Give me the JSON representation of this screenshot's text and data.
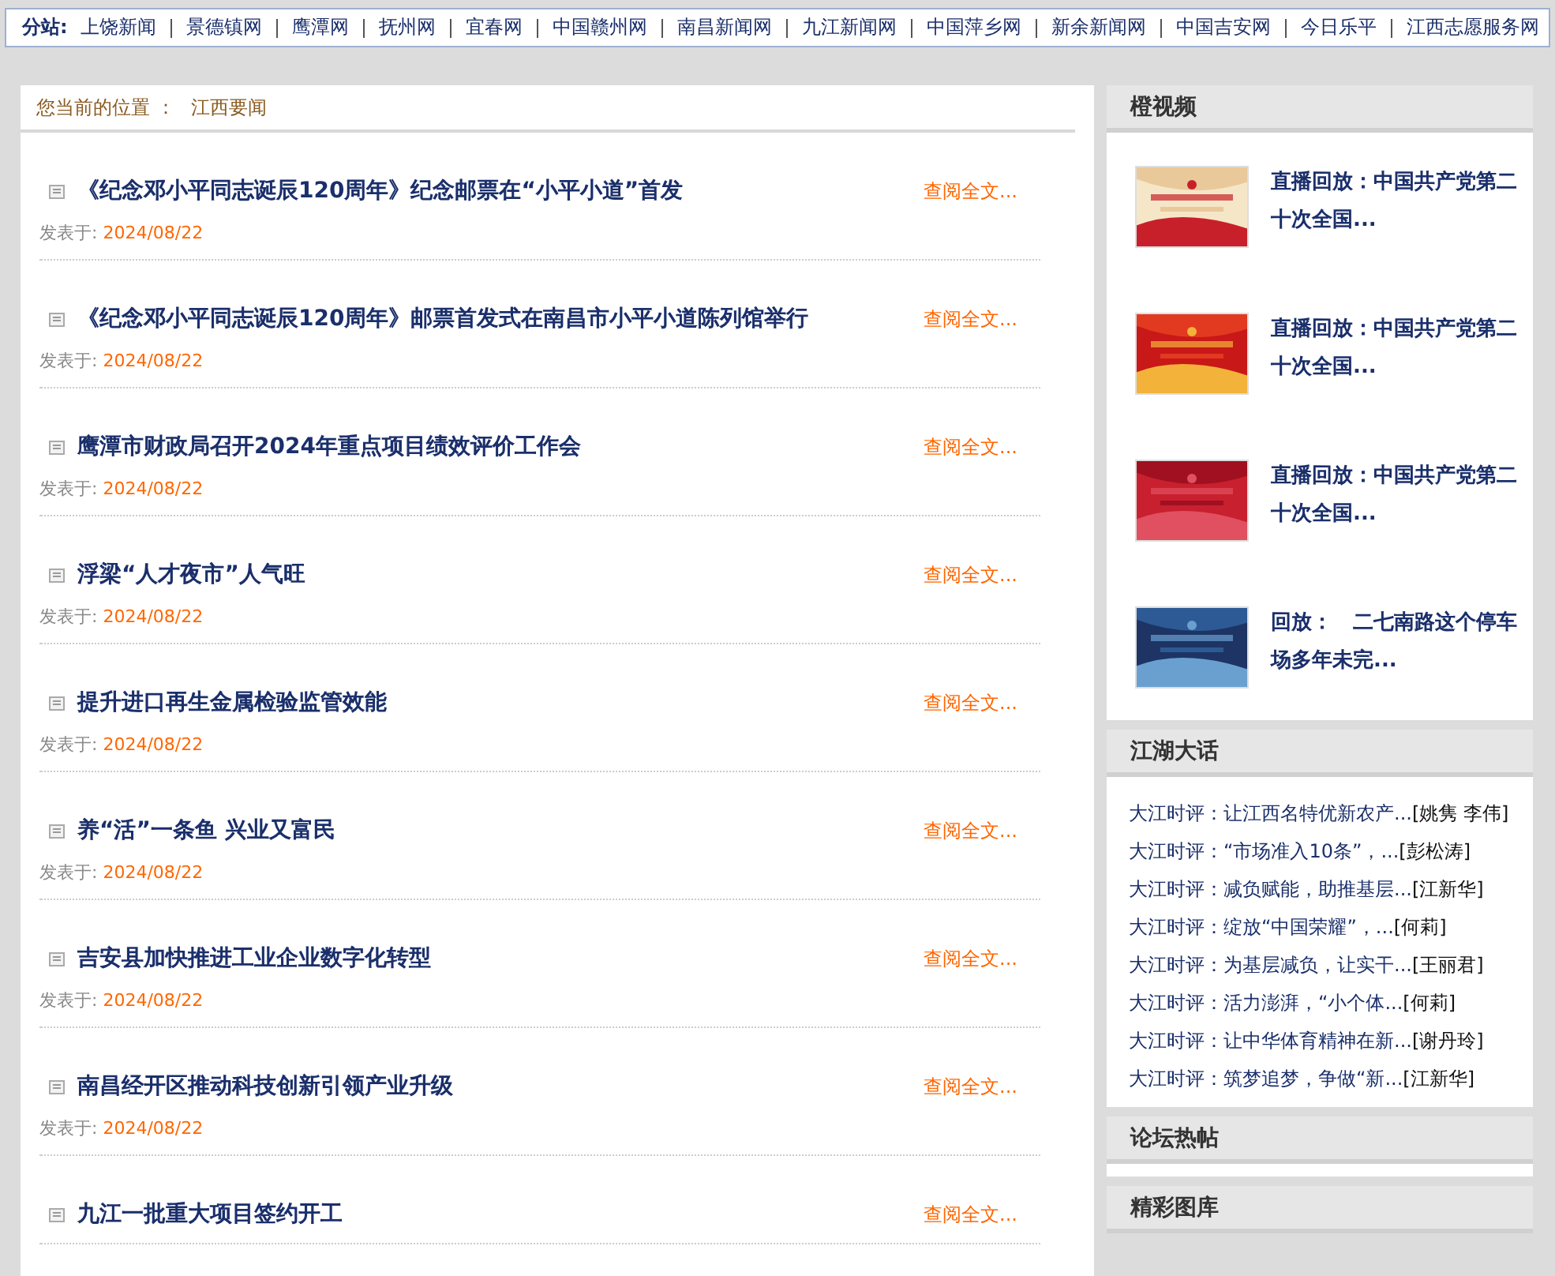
{
  "substation_bar": {
    "label": "分站:",
    "links": [
      "上饶新闻",
      "景德镇网",
      "鹰潭网",
      "抚州网",
      "宜春网",
      "中国赣州网",
      "南昌新闻网",
      "九江新闻网",
      "中国萍乡网",
      "新余新闻网",
      "中国吉安网",
      "今日乐平",
      "江西志愿服务网"
    ]
  },
  "breadcrumb": {
    "label": "您当前的位置 ：",
    "current": "江西要闻"
  },
  "articles": [
    {
      "title": "《纪念邓小平同志诞辰120周年》纪念邮票在“小平小道”首发",
      "date_label": "发表于:",
      "date": "2024/08/22",
      "more": "查阅全文..."
    },
    {
      "title": "《纪念邓小平同志诞辰120周年》邮票首发式在南昌市小平小道陈列馆举行",
      "date_label": "发表于:",
      "date": "2024/08/22",
      "more": "查阅全文..."
    },
    {
      "title": "鹰潭市财政局召开2024年重点项目绩效评价工作会",
      "date_label": "发表于:",
      "date": "2024/08/22",
      "more": "查阅全文..."
    },
    {
      "title": "浮梁“人才夜市”人气旺",
      "date_label": "发表于:",
      "date": "2024/08/22",
      "more": "查阅全文..."
    },
    {
      "title": "提升进口再生金属检验监管效能",
      "date_label": "发表于:",
      "date": "2024/08/22",
      "more": "查阅全文..."
    },
    {
      "title": "养“活”一条鱼 兴业又富民",
      "date_label": "发表于:",
      "date": "2024/08/22",
      "more": "查阅全文..."
    },
    {
      "title": "吉安县加快推进工业企业数字化转型",
      "date_label": "发表于:",
      "date": "2024/08/22",
      "more": "查阅全文..."
    },
    {
      "title": "南昌经开区推动科技创新引领产业升级",
      "date_label": "发表于:",
      "date": "2024/08/22",
      "more": "查阅全文..."
    },
    {
      "title": "九江一批重大项目签约开工",
      "more": "查阅全文..."
    }
  ],
  "sidebar": {
    "video_section": {
      "title": "橙视频",
      "items": [
        {
          "kind": "picture",
          "caption": "直播回放：中国共产党第二十次全国..."
        },
        {
          "kind": "picture",
          "caption": "直播回放：中国共产党第二十次全国..."
        },
        {
          "kind": "picture",
          "caption": "直播回放：中国共产党第二十次全国..."
        },
        {
          "kind": "picture",
          "caption": "回放：　二七南路这个停车场多年未完..."
        }
      ]
    },
    "talk_section": {
      "title": "江湖大话",
      "items": [
        {
          "title": "大江时评：让江西名特优新农产...",
          "author": "[姚隽 李伟]"
        },
        {
          "title": "大江时评：“市场准入10条”，...",
          "author": "[彭松涛]"
        },
        {
          "title": "大江时评：减负赋能，助推基层...",
          "author": "[江新华]"
        },
        {
          "title": "大江时评：绽放“中国荣耀”，...",
          "author": "[何莉]"
        },
        {
          "title": "大江时评：为基层减负，让实干...",
          "author": "[王丽君]"
        },
        {
          "title": "大江时评：活力澎湃，“小个体...",
          "author": "[何莉]"
        },
        {
          "title": "大江时评：让中华体育精神在新...",
          "author": "[谢丹玲]"
        },
        {
          "title": "大江时评：筑梦追梦，争做“新...",
          "author": "[江新华]"
        }
      ]
    },
    "forum_section": {
      "title": "论坛热帖"
    },
    "gallery_section": {
      "title": "精彩图库"
    }
  }
}
